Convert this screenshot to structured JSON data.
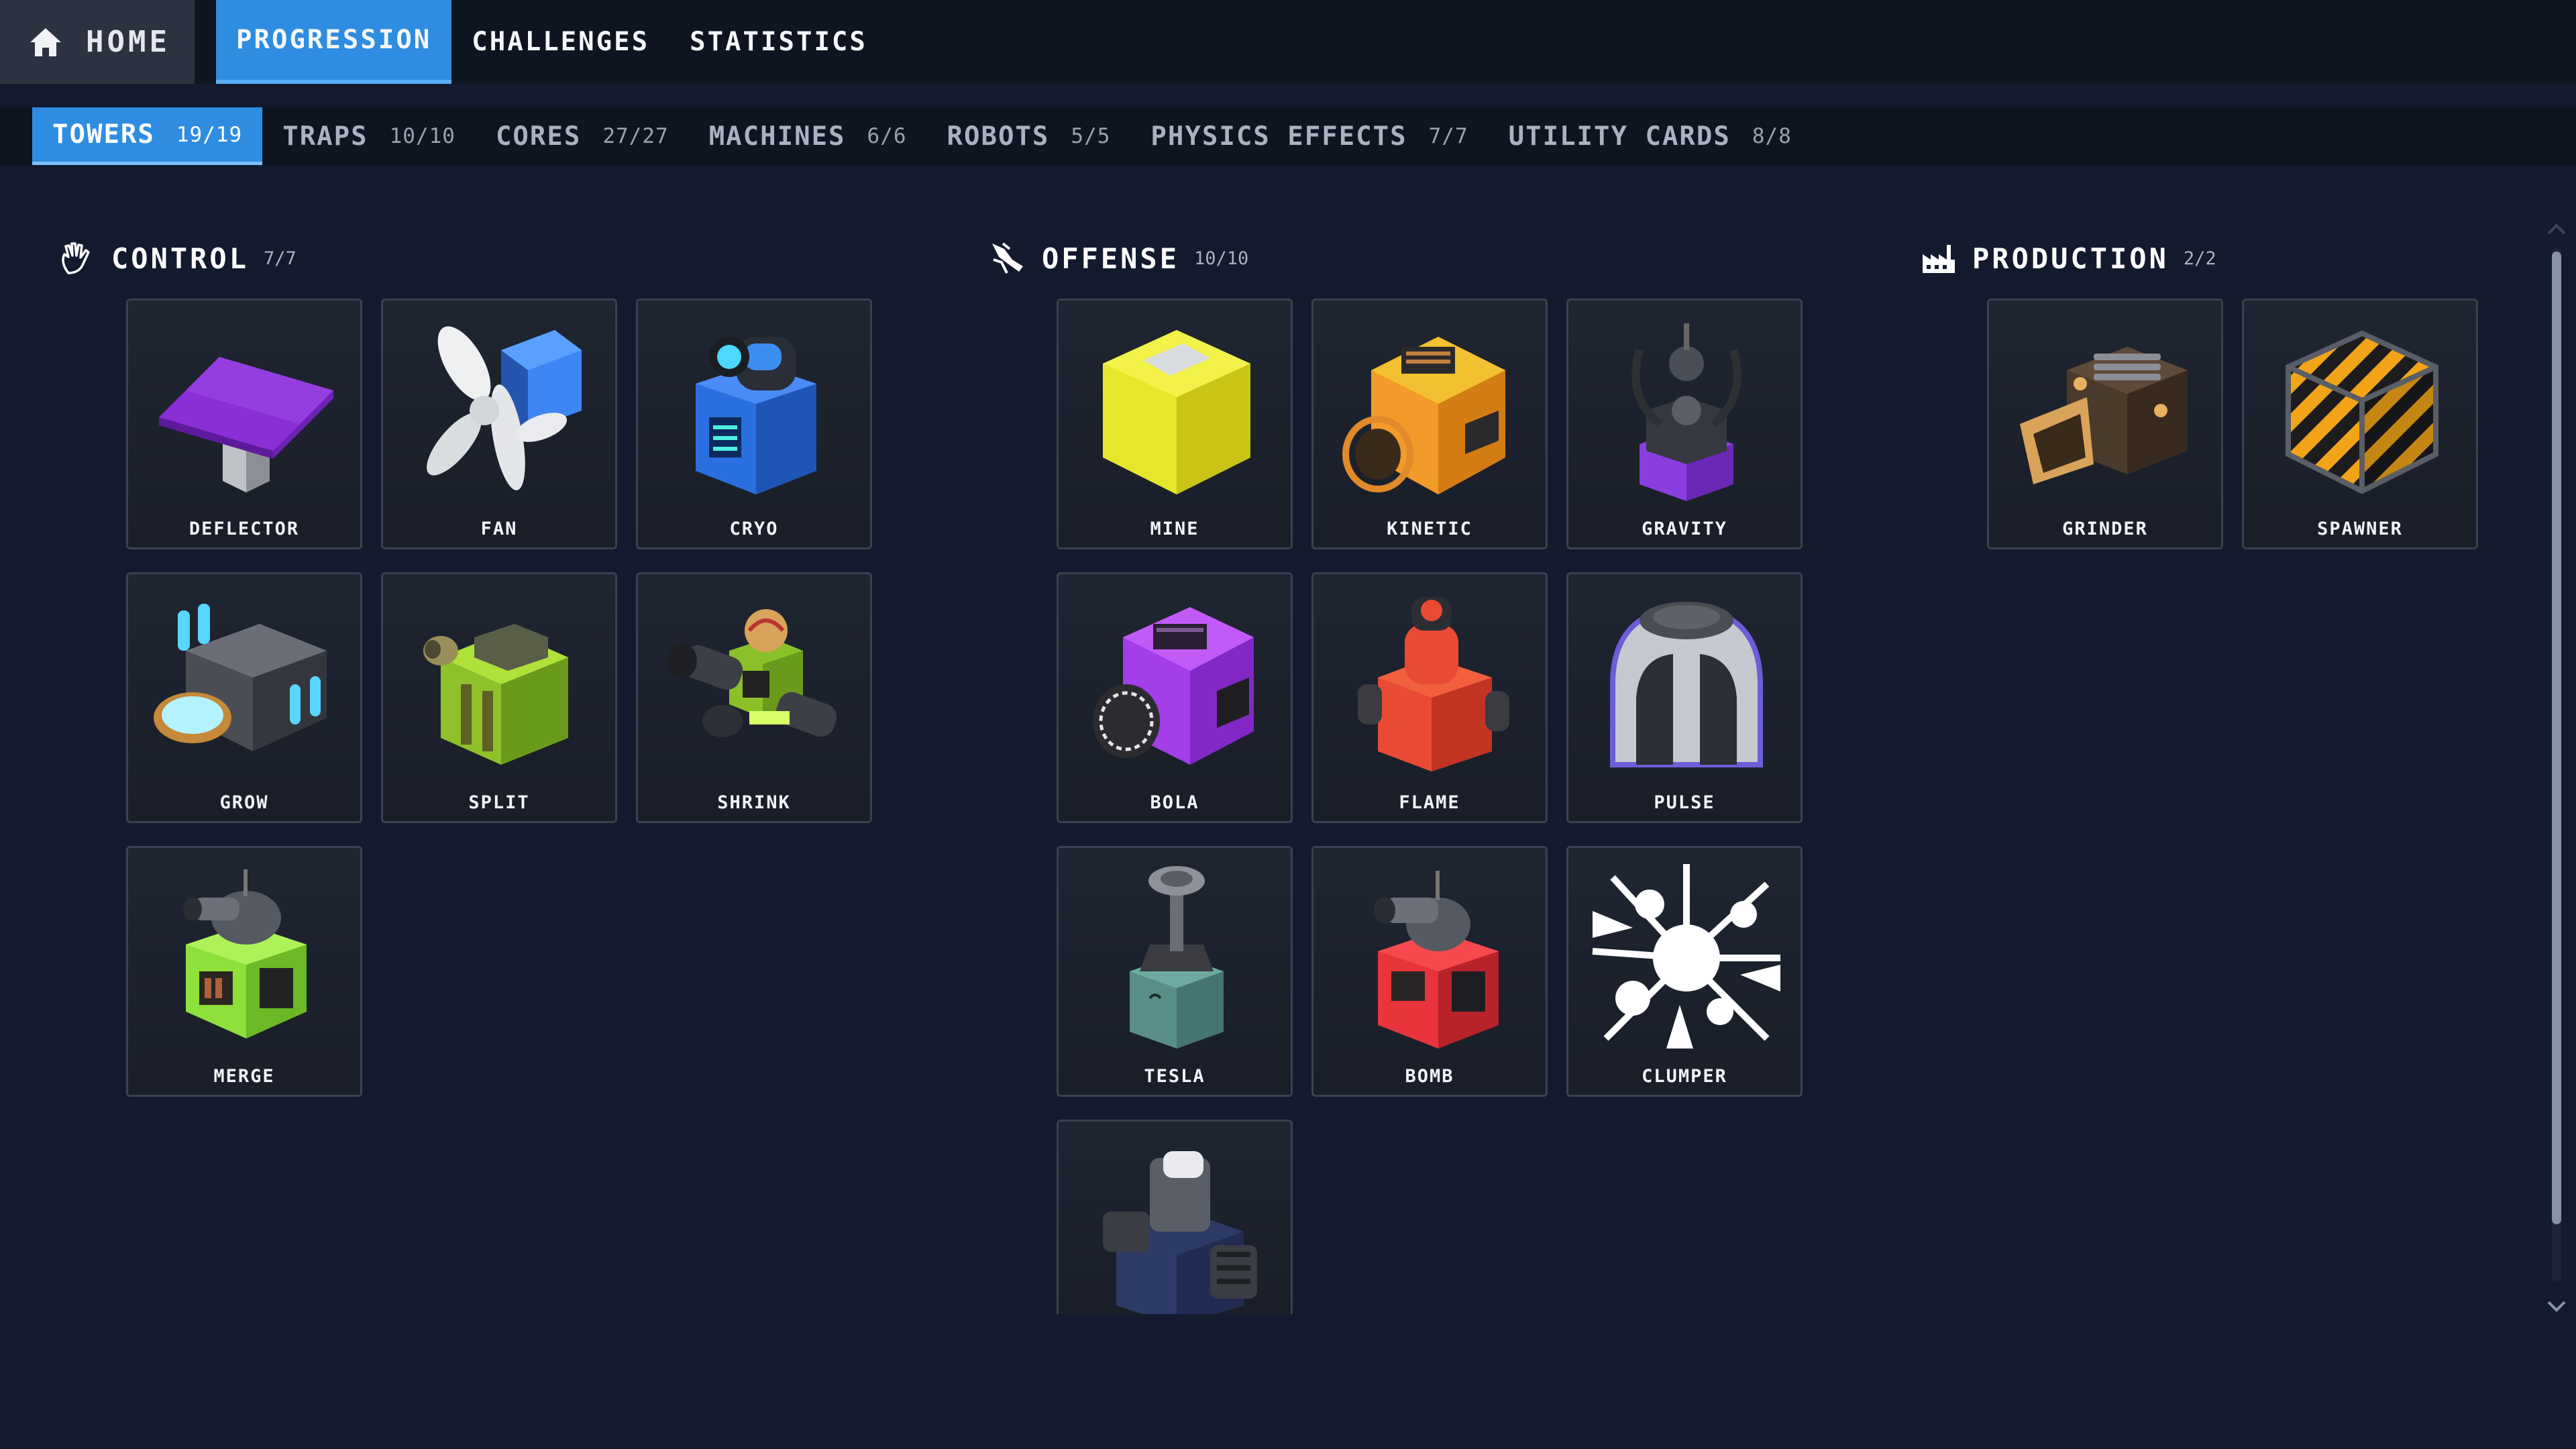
{
  "nav": {
    "home_label": "HOME",
    "tabs": [
      {
        "label": "PROGRESSION",
        "active": true
      },
      {
        "label": "CHALLENGES",
        "active": false
      },
      {
        "label": "STATISTICS",
        "active": false
      }
    ]
  },
  "subnav": {
    "tabs": [
      {
        "label": "TOWERS",
        "count": "19/19",
        "active": true
      },
      {
        "label": "TRAPS",
        "count": "10/10",
        "active": false
      },
      {
        "label": "CORES",
        "count": "27/27",
        "active": false
      },
      {
        "label": "MACHINES",
        "count": "6/6",
        "active": false
      },
      {
        "label": "ROBOTS",
        "count": "5/5",
        "active": false
      },
      {
        "label": "PHYSICS EFFECTS",
        "count": "7/7",
        "active": false
      },
      {
        "label": "UTILITY CARDS",
        "count": "8/8",
        "active": false
      }
    ]
  },
  "sections": {
    "control": {
      "title": "CONTROL",
      "count": "7/7",
      "icon": "hand-icon",
      "items": [
        "DEFLECTOR",
        "FAN",
        "CRYO",
        "GROW",
        "SPLIT",
        "SHRINK",
        "MERGE"
      ]
    },
    "offense": {
      "title": "OFFENSE",
      "count": "10/10",
      "icon": "strike-icon",
      "items": [
        "MINE",
        "KINETIC",
        "GRAVITY",
        "BOLA",
        "FLAME",
        "PULSE",
        "TESLA",
        "BOMB",
        "CLUMPER",
        ""
      ]
    },
    "production": {
      "title": "PRODUCTION",
      "count": "2/2",
      "icon": "factory-icon",
      "items": [
        "GRINDER",
        "SPAWNER"
      ]
    }
  },
  "colors": {
    "accent": "#2e8de0",
    "background": "#131a2e",
    "card": "#1c212c"
  }
}
